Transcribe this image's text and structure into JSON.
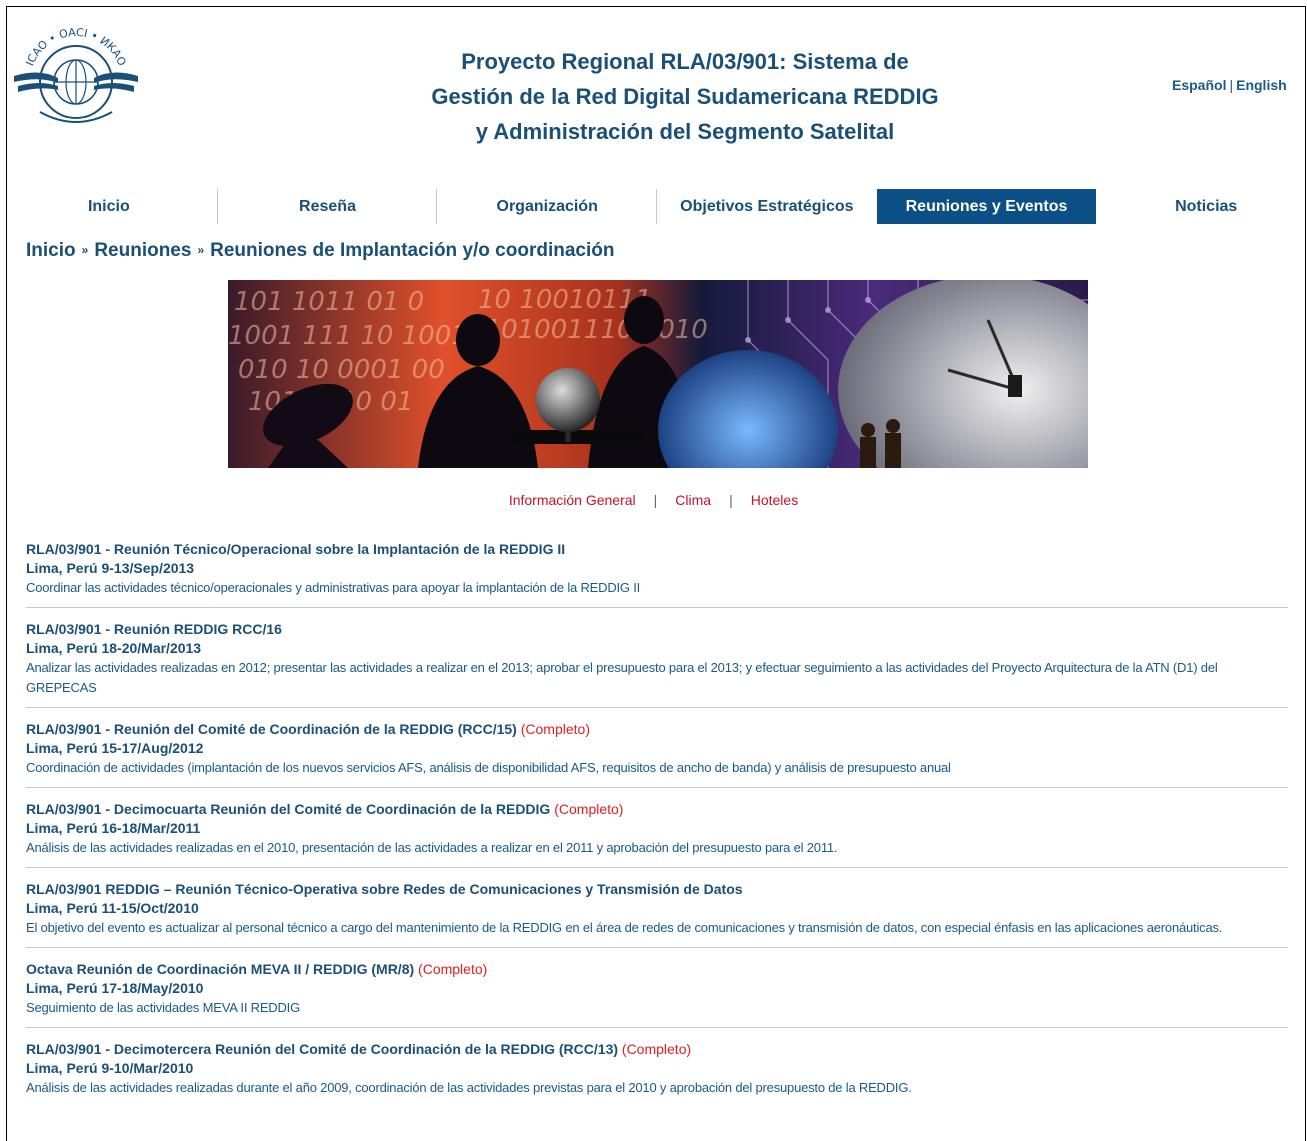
{
  "header": {
    "logo_icon": "icao-emblem-icon",
    "logo_text": "ICAO • OACI • ИКАО",
    "title_lines": [
      "Proyecto Regional RLA/03/901: Sistema de",
      "Gestión de la Red Digital Sudamericana REDDIG",
      "y Administración del Segmento Satelital"
    ],
    "lang_es": "Español",
    "lang_sep": "|",
    "lang_en": "English"
  },
  "nav": {
    "items": [
      {
        "label": "Inicio"
      },
      {
        "label": "Reseña"
      },
      {
        "label": "Organización"
      },
      {
        "label": "Objetivos Estratégicos"
      },
      {
        "label": "Reuniones y Eventos"
      },
      {
        "label": "Noticias"
      }
    ],
    "active_index": 4
  },
  "breadcrumb": {
    "items": [
      "Inicio",
      "Reuniones",
      "Reuniones de Implantación y/o coordinación"
    ],
    "sep": "»"
  },
  "banner": {
    "icon": "satellite-dish-banner-icon"
  },
  "sublinks": {
    "items": [
      "Información General",
      "Clima",
      "Hoteles"
    ],
    "sep": "|"
  },
  "events": [
    {
      "title": "RLA/03/901 - Reunión Técnico/Operacional sobre la Implantación de la REDDIG II",
      "tag": "",
      "place": "Lima, Perú 9-13/Sep/2013",
      "desc": "Coordinar las actividades técnico/operacionales y administrativas para apoyar la implantación de la REDDIG II"
    },
    {
      "title": "RLA/03/901 - Reunión REDDIG RCC/16",
      "tag": "",
      "place": "Lima, Perú 18-20/Mar/2013",
      "desc": "Analizar las actividades realizadas en 2012; presentar las actividades a realizar en el 2013; aprobar el presupuesto para el 2013; y efectuar seguimiento a las actividades del Proyecto Arquitectura de la ATN (D1) del GREPECAS"
    },
    {
      "title": "RLA/03/901 - Reunión del Comité de Coordinación de la REDDIG (RCC/15)",
      "tag": "(Completo)",
      "place": "Lima, Perú 15-17/Aug/2012",
      "desc": "Coordinación de actividades (implantación de los nuevos servicios AFS, análisis de disponibilidad AFS, requisitos de ancho de banda) y análisis de presupuesto anual"
    },
    {
      "title": "RLA/03/901 - Decimocuarta Reunión del Comité de Coordinación de la REDDIG",
      "tag": "(Completo)",
      "place": "Lima, Perú 16-18/Mar/2011",
      "desc": "Análisis de las actividades realizadas en el 2010, presentación de las actividades a realizar en el 2011 y aprobación del presupuesto para el 2011."
    },
    {
      "title": "RLA/03/901 REDDIG – Reunión Técnico-Operativa sobre Redes de Comunicaciones y Transmisión de Datos",
      "tag": "",
      "place": "Lima, Perú 11-15/Oct/2010",
      "desc": "El objetivo del evento es actualizar al personal técnico a cargo del mantenimiento de la REDDIG en el área de redes de comunicaciones y transmisión de datos, con especial énfasis en las aplicaciones aeronáuticas."
    },
    {
      "title": "Octava Reunión de Coordinación MEVA II / REDDIG (MR/8)",
      "tag": "(Completo)",
      "place": "Lima, Perú 17-18/May/2010",
      "desc": "Seguimiento de las actividades MEVA II REDDIG"
    },
    {
      "title": "RLA/03/901 - Decimotercera Reunión del Comité de Coordinación de la REDDIG (RCC/13)",
      "tag": "(Completo)",
      "place": "Lima, Perú 9-10/Mar/2010",
      "desc": "Análisis de las actividades realizadas durante el año 2009, coordinación de las actividades previstas para el 2010 y aprobación del presupuesto de la REDDIG."
    }
  ]
}
